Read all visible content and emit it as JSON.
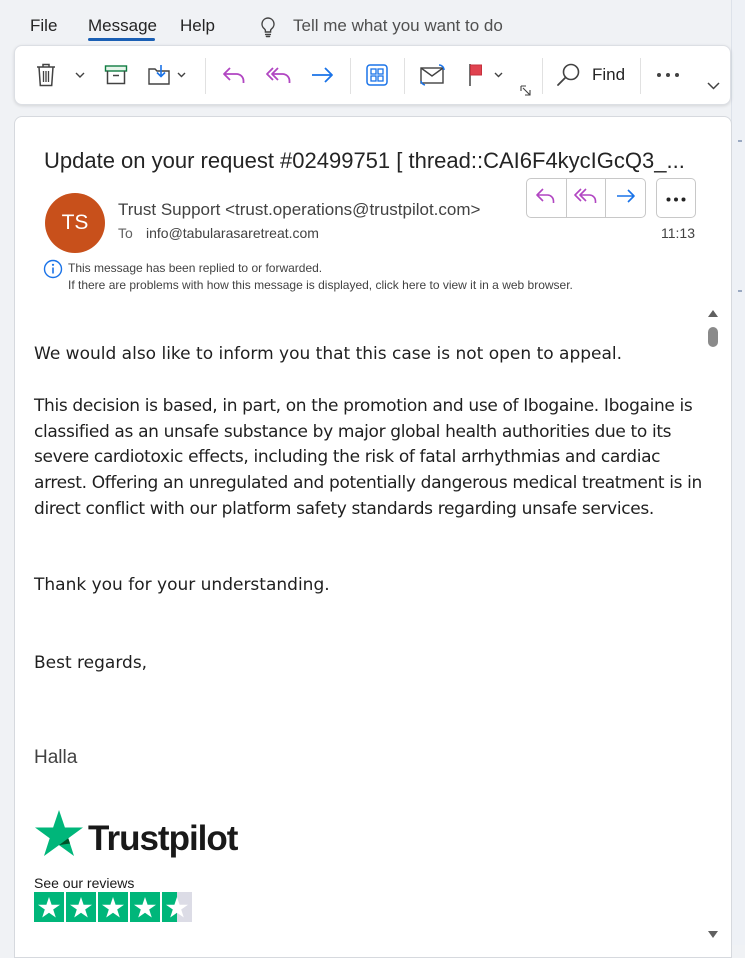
{
  "menu": {
    "items": [
      "File",
      "Message",
      "Help"
    ],
    "tell_me": "Tell me what you want to do"
  },
  "ribbon": {
    "find_label": "Find",
    "icons": [
      "delete-icon",
      "chevron-down-icon",
      "archive-icon",
      "move-to-folder-icon",
      "reply-icon",
      "reply-all-icon",
      "forward-icon",
      "apps-icon",
      "mark-read-icon",
      "flag-icon",
      "expand-icon",
      "search-icon",
      "more-icon",
      "collapse-ribbon-icon"
    ]
  },
  "message": {
    "subject": "Update on your request #02499751 [ thread::CAI6F4kycIGcQ3_...",
    "avatar_initials": "TS",
    "sender": "Trust Support <trust.operations@trustpilot.com>",
    "to_label": "To",
    "to_address": "info@tabularasaretreat.com",
    "time": "11:13",
    "info_line1": "This message has been replied to or forwarded.",
    "info_line2": "If there are problems with how this message is displayed, click here to view it in a web browser."
  },
  "body": {
    "p1": "We would also like to inform you that this case is not open to appeal.",
    "p2": " This decision is based, in part, on the promotion and use of Ibogaine. Ibogaine is classified as an unsafe substance by major global health authorities due to its severe cardiotoxic effects, including the risk of fatal arrhythmias and cardiac arrest. Offering an unregulated and potentially dangerous medical treatment is in direct conflict with our platform safety standards regarding unsafe services.",
    "p3": "Thank you for your understanding.",
    "p4": "Best regards,",
    "signature_name": "Halla"
  },
  "signature": {
    "logo_text": "Trustpilot",
    "see_reviews": "See our reviews",
    "rating_stars": 4.5
  },
  "colors": {
    "avatar": "#c8501b",
    "accent": "#1a5fb4",
    "reply_purple": "#b146c2",
    "forward_blue": "#1a73e8",
    "trustpilot_green": "#00b67a"
  }
}
